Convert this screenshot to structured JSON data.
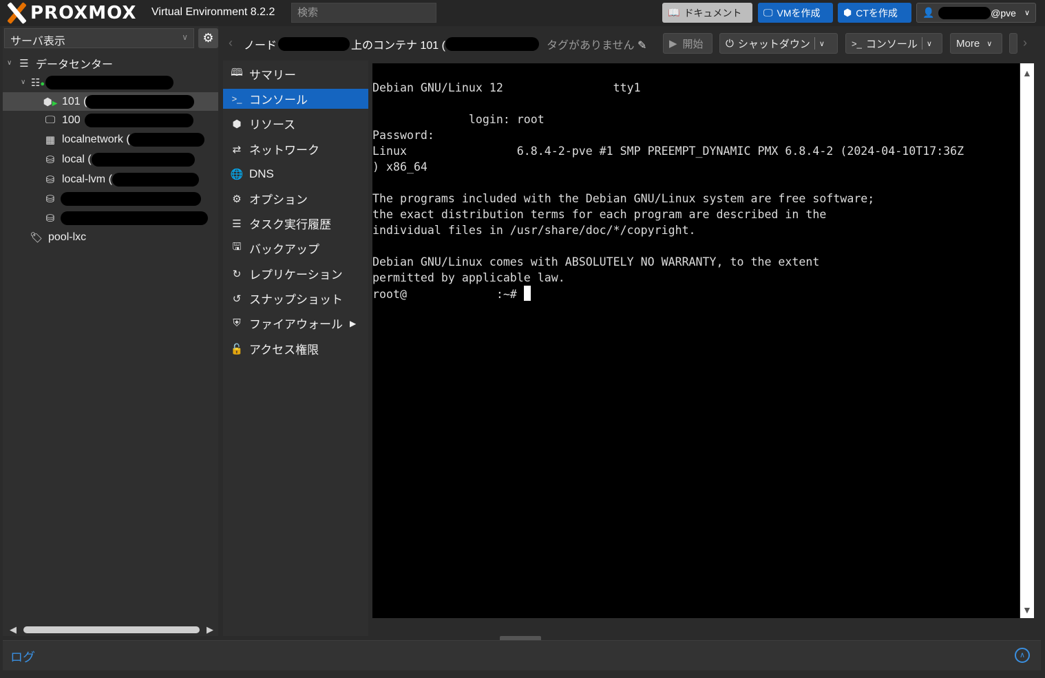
{
  "header": {
    "brand": "PROXMOX",
    "version": "Virtual Environment 8.2.2",
    "search_placeholder": "検索",
    "docs_label": "ドキュメント",
    "create_vm_label": "VMを作成",
    "create_ct_label": "CTを作成",
    "user_suffix": "@pve"
  },
  "sidebar": {
    "view_label": "サーバ表示",
    "tree": [
      {
        "label": "データセンター",
        "icon": "datacenter-icon"
      },
      {
        "label": "",
        "icon": "node-online-icon"
      },
      {
        "label": "101 (",
        "icon": "container-running-icon"
      },
      {
        "label": "100",
        "icon": "vm-icon"
      },
      {
        "label": "localnetwork (",
        "icon": "network-grid-icon"
      },
      {
        "label": "local (",
        "icon": "storage-icon"
      },
      {
        "label": "local-lvm (",
        "icon": "storage-icon"
      },
      {
        "label": "",
        "icon": "storage-unknown-icon"
      },
      {
        "label": "",
        "icon": "storage-icon"
      },
      {
        "label": "pool-lxc",
        "icon": "tags-icon"
      }
    ]
  },
  "toolbar": {
    "title_prefix": "ノード",
    "title_middle": "上のコンテナ 101 (",
    "tags_label": "タグがありません",
    "start_label": "開始",
    "shutdown_label": "シャットダウン",
    "console_label": "コンソール",
    "more_label": "More"
  },
  "menu": [
    {
      "label": "サマリー",
      "icon": "book-icon"
    },
    {
      "label": "コンソール",
      "icon": "terminal-icon"
    },
    {
      "label": "リソース",
      "icon": "cube-icon"
    },
    {
      "label": "ネットワーク",
      "icon": "exchange-icon"
    },
    {
      "label": "DNS",
      "icon": "globe-icon"
    },
    {
      "label": "オプション",
      "icon": "gear-icon"
    },
    {
      "label": "タスク実行履歴",
      "icon": "list-icon"
    },
    {
      "label": "バックアップ",
      "icon": "floppy-icon"
    },
    {
      "label": "レプリケーション",
      "icon": "retweet-icon"
    },
    {
      "label": "スナップショット",
      "icon": "history-icon"
    },
    {
      "label": "ファイアウォール",
      "icon": "shield-icon"
    },
    {
      "label": "アクセス権限",
      "icon": "unlock-icon"
    }
  ],
  "terminal": {
    "lines": [
      "Debian GNU/Linux 12                tty1",
      "",
      "              login: root",
      "Password:",
      "Linux                6.8.4-2-pve #1 SMP PREEMPT_DYNAMIC PMX 6.8.4-2 (2024-04-10T17:36Z",
      ") x86_64",
      "",
      "The programs included with the Debian GNU/Linux system are free software;",
      "the exact distribution terms for each program are described in the",
      "individual files in /usr/share/doc/*/copyright.",
      "",
      "Debian GNU/Linux comes with ABSOLUTELY NO WARRANTY, to the extent",
      "permitted by applicable law.",
      "root@             :~# "
    ]
  },
  "log": {
    "label": "ログ"
  }
}
